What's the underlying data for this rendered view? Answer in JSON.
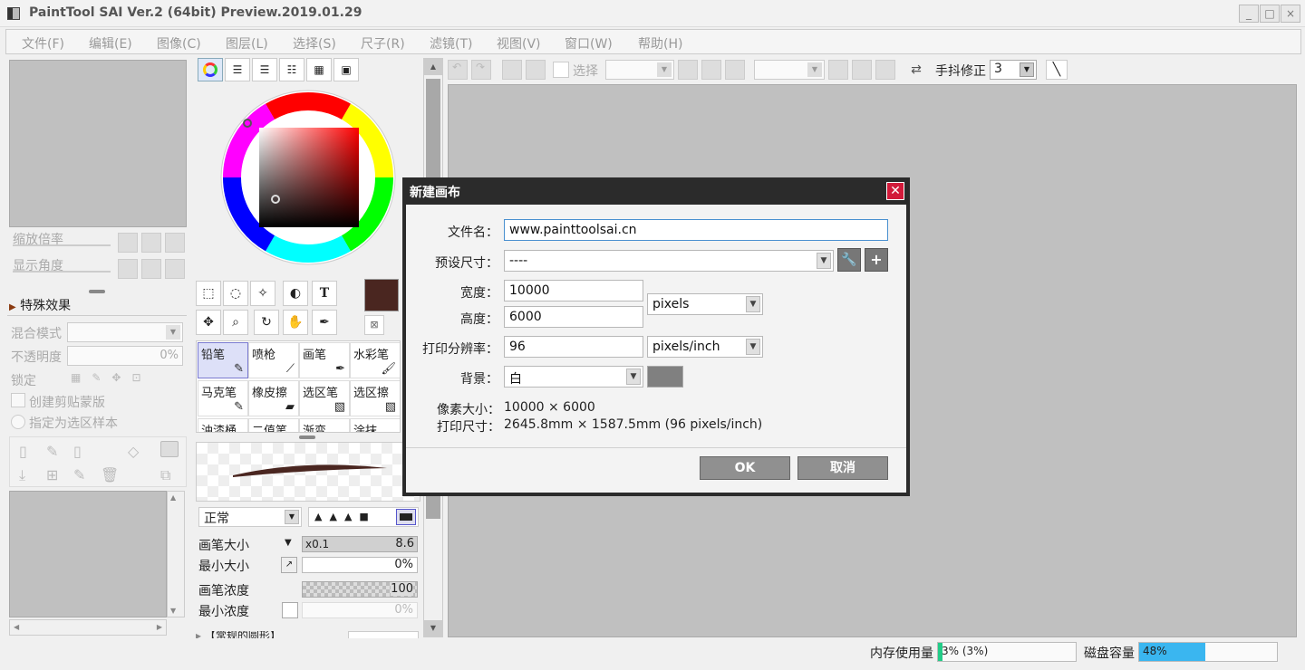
{
  "window": {
    "title": "PaintTool SAI Ver.2 (64bit) Preview.2019.01.29",
    "min": "_",
    "max": "□",
    "close": "×"
  },
  "menu": [
    "文件(F)",
    "编辑(E)",
    "图像(C)",
    "图层(L)",
    "选择(S)",
    "尺子(R)",
    "滤镜(T)",
    "视图(V)",
    "窗口(W)",
    "帮助(H)"
  ],
  "navigator": {
    "zoom_label": "缩放倍率",
    "angle_label": "显示角度"
  },
  "layer_panel": {
    "effects_label": "特殊效果",
    "blend_label": "混合模式",
    "opacity_label": "不透明度",
    "opacity_value": "0%",
    "lock_label": "锁定",
    "clip_label": "创建剪贴蒙版",
    "select_source_label": "指定为选区样本"
  },
  "color": {
    "primary": "#4a2620"
  },
  "brushes": [
    {
      "name": "铅笔",
      "selected": true
    },
    {
      "name": "喷枪"
    },
    {
      "name": "画笔"
    },
    {
      "name": "水彩笔"
    },
    {
      "name": "马克笔"
    },
    {
      "name": "橡皮擦"
    },
    {
      "name": "选区笔"
    },
    {
      "name": "选区擦"
    },
    {
      "name": "油漆桶"
    },
    {
      "name": "二值笔"
    },
    {
      "name": "渐变"
    },
    {
      "name": "涂抹"
    }
  ],
  "brush_settings": {
    "mode_value": "正常",
    "size_label": "画笔大小",
    "size_multiplier": "x0.1",
    "size_value": "8.6",
    "min_size_label": "最小大小",
    "min_size_value": "0%",
    "density_label": "画笔浓度",
    "density_value": "100",
    "min_density_label": "最小浓度",
    "min_density_value": "0%",
    "shape_preset": "【常规的圆形】"
  },
  "toolbar": {
    "select_label": "选择",
    "stabilizer_label": "手抖修正",
    "stabilizer_value": "3"
  },
  "dialog": {
    "title": "新建画布",
    "filename_label": "文件名：",
    "filename_value": "www.painttoolsai.cn",
    "preset_label": "预设尺寸：",
    "preset_value": "----",
    "width_label": "宽度：",
    "width_value": "10000",
    "height_label": "高度：",
    "height_value": "6000",
    "unit_value": "pixels",
    "dpi_label": "打印分辨率：",
    "dpi_value": "96",
    "dpi_unit_value": "pixels/inch",
    "bg_label": "背景：",
    "bg_value": "白",
    "pixel_size_label": "像素大小：",
    "pixel_size_value": "10000 × 6000",
    "print_size_label": "打印尺寸：",
    "print_size_value": "2645.8mm × 1587.5mm (96 pixels/inch)",
    "ok": "OK",
    "cancel": "取消"
  },
  "status": {
    "memory_label": "内存使用量",
    "memory_value": "3% (3%)",
    "memory_fraction": 0.03,
    "disk_label": "磁盘容量",
    "disk_value": "48%",
    "disk_fraction": 0.48
  }
}
